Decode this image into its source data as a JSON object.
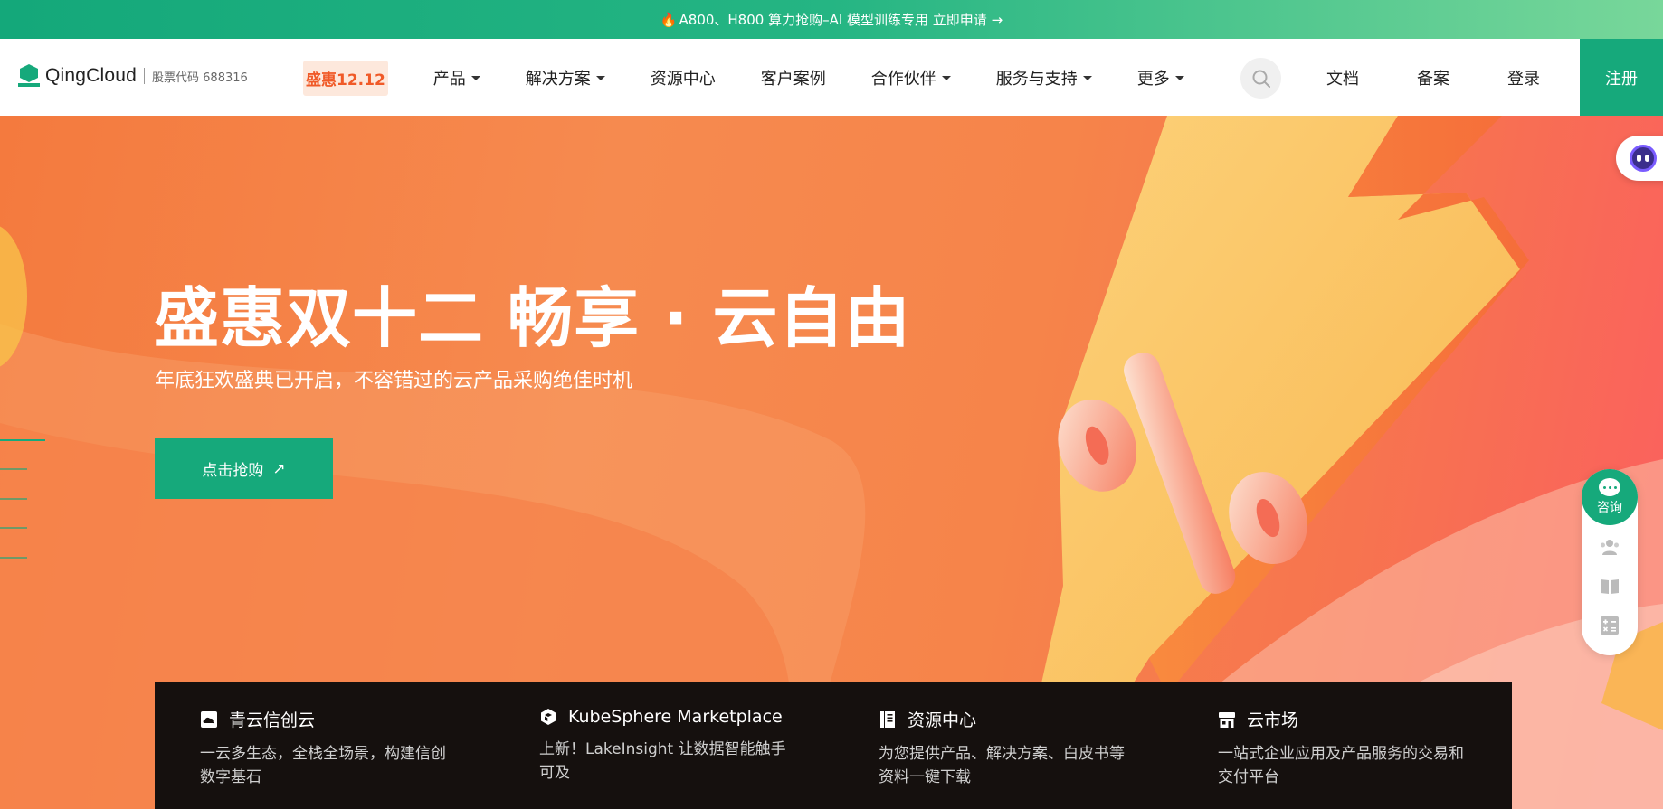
{
  "promo_bar": {
    "icon": "fire-icon",
    "text": "A800、H800 算力抢购–AI 模型训练专用 立即申请 →"
  },
  "header": {
    "logo_text": "QingCloud",
    "stock_code": "股票代码 688316",
    "promo_tag": "盛惠12.12",
    "nav": [
      {
        "label": "产品",
        "dropdown": true
      },
      {
        "label": "解决方案",
        "dropdown": true
      },
      {
        "label": "资源中心",
        "dropdown": false
      },
      {
        "label": "客户案例",
        "dropdown": false
      },
      {
        "label": "合作伙伴",
        "dropdown": true
      },
      {
        "label": "服务与支持",
        "dropdown": true
      },
      {
        "label": "更多",
        "dropdown": true
      }
    ],
    "docs": "文档",
    "filing": "备案",
    "login": "登录",
    "register": "注册"
  },
  "hero": {
    "title": "盛惠双十二 畅享 · 云自由",
    "subtitle": "年底狂欢盛典已开启，不容错过的云产品采购绝佳时机",
    "cta": "点击抢购",
    "cta_arrow": "↗"
  },
  "side_panel": {
    "consult": "咨询"
  },
  "cards": [
    {
      "icon": "cloud-icon",
      "title": "青云信创云",
      "desc": "一云多生态，全栈全场景，构建信创数字基石"
    },
    {
      "icon": "cube-icon",
      "title": "KubeSphere Marketplace",
      "desc": "上新！LakeInsight 让数据智能触手可及"
    },
    {
      "icon": "document-icon",
      "title": "资源中心",
      "desc": "为您提供产品、解决方案、白皮书等资料一键下载"
    },
    {
      "icon": "store-icon",
      "title": "云市场",
      "desc": "一站式企业应用及产品服务的交易和交付平台"
    }
  ],
  "colors": {
    "brand_green": "#16a97b",
    "promo_orange": "#f05a28",
    "hero_orange": "#f68a4f",
    "card_bg": "#15100e"
  }
}
